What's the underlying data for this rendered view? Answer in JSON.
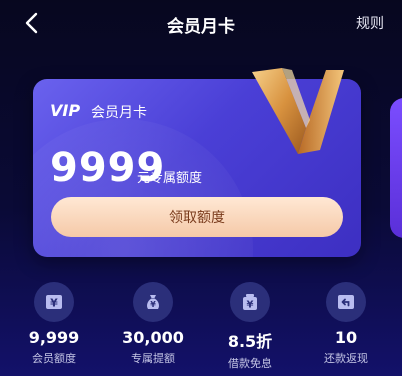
{
  "header": {
    "title": "会员月卡",
    "rules_label": "规则"
  },
  "card": {
    "vip_text": "VIP",
    "name": "会员月卡",
    "amount": "9999",
    "amount_label": "元专属额度",
    "claim_button": "领取额度"
  },
  "benefits": [
    {
      "value": "9,999",
      "label": "会员额度",
      "icon": "yen-card-icon"
    },
    {
      "value": "30,000",
      "label": "专属提额",
      "icon": "money-bag-icon"
    },
    {
      "value": "8.5折",
      "label": "借款免息",
      "icon": "yen-box-icon"
    },
    {
      "value": "10",
      "label": "还款返现",
      "icon": "return-arrow-icon"
    }
  ],
  "colors": {
    "background": "#0a0a36",
    "card": "#4a3fd6",
    "button": "#f5c9a8",
    "button_text": "#7a3b1c",
    "icon_bg": "#2b2f7a",
    "gold": "#e0a24a"
  }
}
